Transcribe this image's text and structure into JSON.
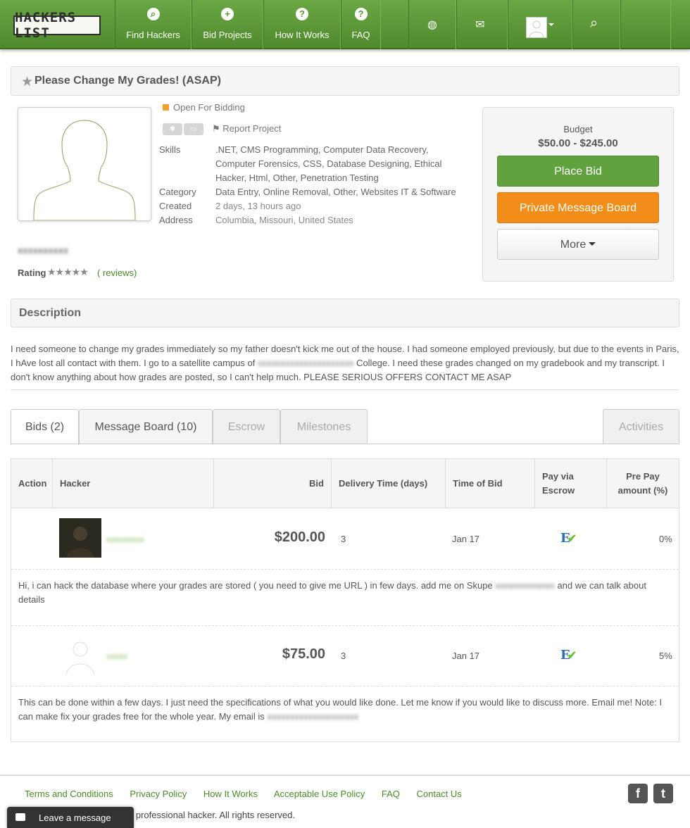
{
  "nav": {
    "logo": "HACKERS LIST",
    "items": [
      {
        "label": "Find Hackers",
        "icon": "search-icon"
      },
      {
        "label": "Bid Projects",
        "icon": "plus-circle-icon"
      },
      {
        "label": "How It Works",
        "icon": "question-circle-icon"
      },
      {
        "label": "FAQ",
        "icon": "question-circle-icon"
      }
    ],
    "globe_icon": "globe-icon",
    "mail_icon": "envelope-icon",
    "search_icon": "search-icon"
  },
  "project": {
    "title": "Please Change My Grades! (ASAP)",
    "status": "Open For Bidding",
    "report_label": "Report Project",
    "skills_label": "Skills",
    "skills": ".NET, CMS Programming, Computer Data Recovery, Computer Forensics, CSS, Database Designing, Ethical Hacker, Html, Other, Penetration Testing",
    "category_label": "Category",
    "category": "Data Entry, Online Removal, Other, Websites IT & Software",
    "created_label": "Created",
    "created": "2 days, 13 hours ago",
    "address_label": "Address",
    "address": "Columbia, Missouri, United States",
    "username": "xxxxxxxxxx",
    "rating_label": "Rating",
    "rating_stars": "★★★★★",
    "reviews_label": "( reviews)"
  },
  "budget": {
    "label": "Budget",
    "value": "$50.00 - $245.00",
    "place_bid": "Place Bid",
    "private_board": "Private Message Board",
    "more": "More"
  },
  "description": {
    "heading": "Description",
    "text_before": "I need someone to change my grades immediately so my father doesn't kick me out of the house. I had someone employed previously, but due to the events in Paris, I hAve lost all contact with them. I go to a satellite campus of ",
    "text_blur": "xxxxxxxxxxxxxxxxxxxxx",
    "text_after": " College. I need these grades changed on my gradebook and my transcript. I don't know anything about how grades are posted, so I can't help much. PLEASE SERIOUS OFFERS CONTACT ME ASAP"
  },
  "tabs": [
    {
      "label": "Bids (2)"
    },
    {
      "label": "Message Board (10)"
    },
    {
      "label": "Escrow"
    },
    {
      "label": "Milestones"
    },
    {
      "label": "Activities"
    }
  ],
  "table": {
    "headers": {
      "action": "Action",
      "hacker": "Hacker",
      "bid": "Bid",
      "delivery": "Delivery Time (days)",
      "time": "Time of Bid",
      "escrow": "Pay via Escrow",
      "prepay": "Pre Pay amount (%)"
    },
    "rows": [
      {
        "name": "xxxxxxxxx",
        "bid": "$200.00",
        "delivery": "3",
        "time": "Jan 17",
        "escrow_glyph": "E",
        "prepay": "0%",
        "comment_before": "Hi, i can hack the database where your grades are stored ( you need to give me URL ) in few days. add me on Skupe ",
        "comment_blur": "xxxxxxxxxxxxx",
        "comment_after": " and we can talk about details"
      },
      {
        "name": "xxxxx",
        "bid": "$75.00",
        "delivery": "3",
        "time": "Jan 17",
        "escrow_glyph": "E",
        "prepay": "5%",
        "comment_before": "This can be done within a few days. I just need the specifications of what you would like done. Let me know if you would like to discuss more. Email me! Note: I can make fix your grades free for the whole year. My email is ",
        "comment_blur": "xxxxxxxxxxxxxxxxxxxx",
        "comment_after": ""
      }
    ]
  },
  "footer": {
    "links": [
      "Terms and Conditions",
      "Privacy Policy",
      "How It Works",
      "Acceptable Use Policy",
      "FAQ",
      "Contact Us"
    ],
    "copyright_tail": "a professional hacker. All rights reserved.",
    "leave_message": "Leave a message",
    "facebook": "f",
    "twitter": "t"
  },
  "colors": {
    "brand_green": "#5a972f",
    "orange": "#f28d1a",
    "link_green": "#4a8a2a"
  }
}
